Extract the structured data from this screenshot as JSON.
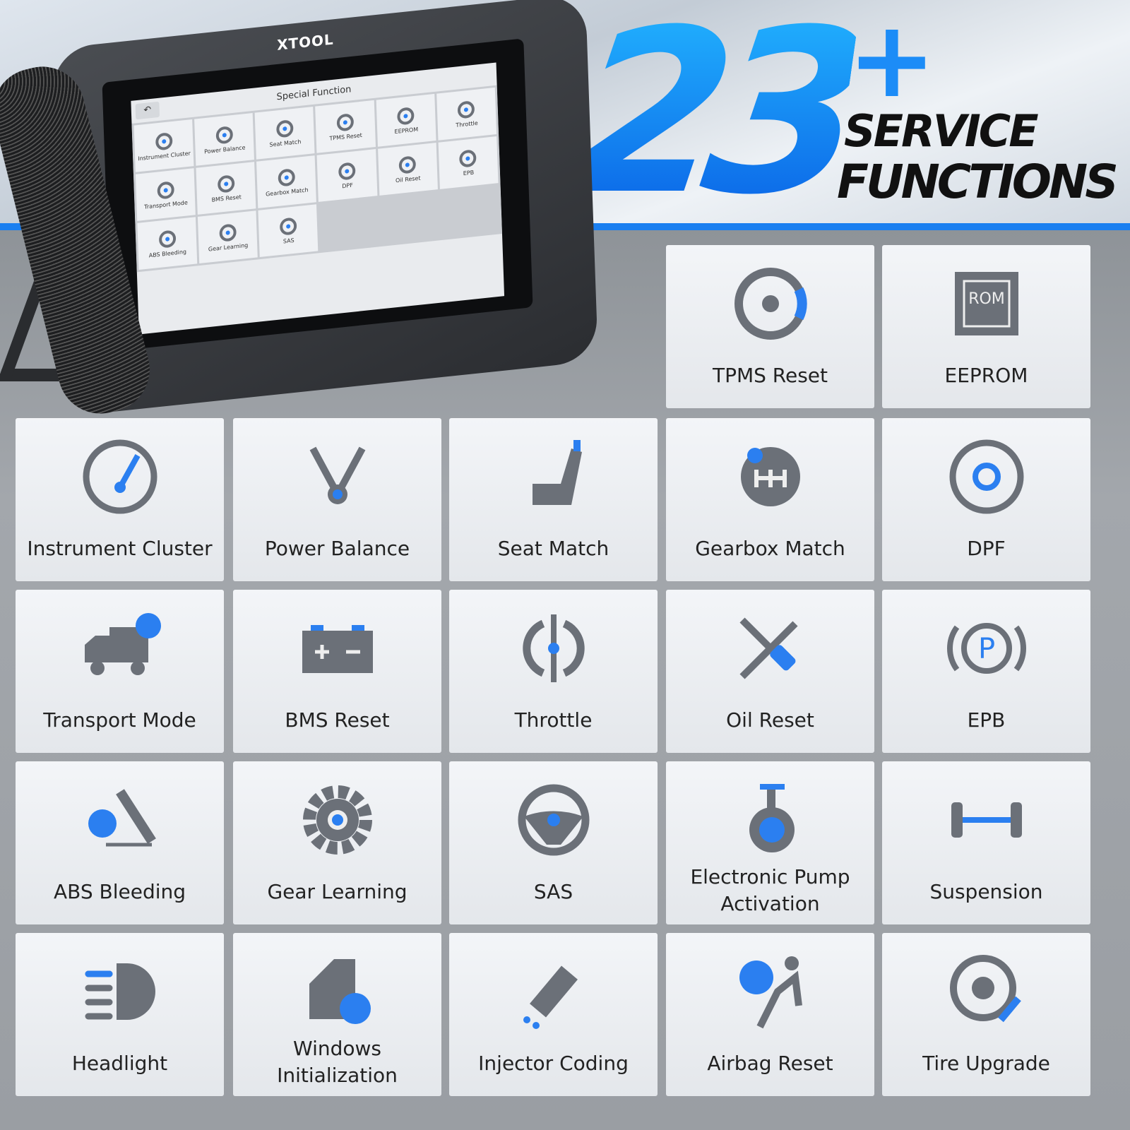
{
  "headline": {
    "count": "23",
    "plus": "+",
    "line1": "SERVICE",
    "line2": "FUNCTIONS"
  },
  "device": {
    "brand": "XTOOL",
    "screen_title": "Special Function",
    "back_icon": "back-arrow-icon",
    "screen_items": [
      "Instrument Cluster",
      "Power Balance",
      "Seat Match",
      "TPMS Reset",
      "EEPROM",
      "Throttle",
      "Transport Mode",
      "BMS Reset",
      "Gearbox Match",
      "DPF",
      "Oil Reset",
      "EPB",
      "ABS Bleeding",
      "Gear Learning",
      "SAS"
    ]
  },
  "colors": {
    "accent": "#1a7ff0",
    "icon_gray": "#6b7078",
    "tile": "#eef0f3"
  },
  "functions": [
    {
      "label": "TPMS Reset",
      "icon": "tire-pressure-icon"
    },
    {
      "label": "EEPROM",
      "icon": "rom-chip-icon"
    },
    {
      "label": "Instrument Cluster",
      "icon": "gauge-icon"
    },
    {
      "label": "Power Balance",
      "icon": "engine-cylinder-icon"
    },
    {
      "label": "Seat Match",
      "icon": "seat-icon"
    },
    {
      "label": "Gearbox Match",
      "icon": "gear-shift-icon"
    },
    {
      "label": "DPF",
      "icon": "filter-icon"
    },
    {
      "label": "Transport Mode",
      "icon": "truck-icon"
    },
    {
      "label": "BMS Reset",
      "icon": "battery-icon"
    },
    {
      "label": "Throttle",
      "icon": "throttle-icon"
    },
    {
      "label": "Oil Reset",
      "icon": "wrench-screwdriver-icon"
    },
    {
      "label": "EPB",
      "icon": "parking-brake-icon"
    },
    {
      "label": "ABS Bleeding",
      "icon": "brake-bleed-icon"
    },
    {
      "label": "Gear Learning",
      "icon": "gear-icon"
    },
    {
      "label": "SAS",
      "icon": "steering-wheel-icon"
    },
    {
      "label": "Electronic Pump Activation",
      "icon": "pump-icon"
    },
    {
      "label": "Suspension",
      "icon": "suspension-icon"
    },
    {
      "label": "Headlight",
      "icon": "headlight-icon"
    },
    {
      "label": "Windows Initialization",
      "icon": "car-window-icon"
    },
    {
      "label": "Injector Coding",
      "icon": "injector-icon"
    },
    {
      "label": "Airbag Reset",
      "icon": "airbag-icon"
    },
    {
      "label": "Tire Upgrade",
      "icon": "tire-wrench-icon"
    }
  ]
}
